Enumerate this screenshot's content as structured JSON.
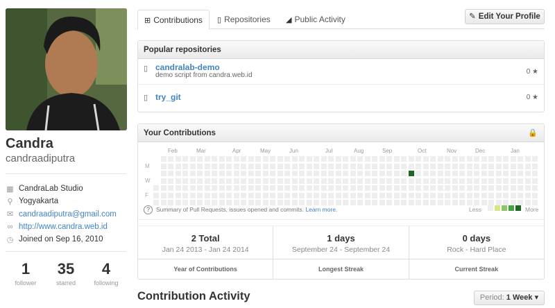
{
  "profile": {
    "fullname": "Candra",
    "username": "candraadiputra",
    "details": [
      {
        "icon": "building-icon",
        "glyph": "▦",
        "text": "CandraLab Studio",
        "link": false
      },
      {
        "icon": "location-icon",
        "glyph": "♥",
        "text": "Yogyakarta",
        "link": false
      },
      {
        "icon": "mail-icon",
        "glyph": "✉",
        "text": "candraadiputra@gmail.com",
        "link": true
      },
      {
        "icon": "link-icon",
        "glyph": "∞",
        "text": "http://www.candra.web.id",
        "link": true
      },
      {
        "icon": "clock-icon",
        "glyph": "◷",
        "text": "Joined on Sep 16, 2010",
        "link": false
      }
    ],
    "stats": [
      {
        "value": "1",
        "label": "follower"
      },
      {
        "value": "35",
        "label": "starred"
      },
      {
        "value": "4",
        "label": "following"
      }
    ]
  },
  "tabs": [
    {
      "label": "Contributions",
      "icon": "plus-box-icon",
      "glyph": "⊞",
      "selected": true
    },
    {
      "label": "Repositories",
      "icon": "repo-icon",
      "glyph": "▯",
      "selected": false
    },
    {
      "label": "Public Activity",
      "icon": "rss-icon",
      "glyph": "◢",
      "selected": false
    }
  ],
  "edit_profile_label": "Edit Your Profile",
  "popular": {
    "title": "Popular repositories",
    "repos": [
      {
        "name": "candralab-demo",
        "description": "demo script from candra.web.id",
        "stars": "0"
      },
      {
        "name": "try_git",
        "description": "",
        "stars": "0"
      }
    ]
  },
  "contributions": {
    "title": "Your Contributions",
    "months": [
      "Feb",
      "Mar",
      "Apr",
      "May",
      "Jun",
      "Jul",
      "Aug",
      "Sep",
      "Oct",
      "Nov",
      "Dec",
      "Jan"
    ],
    "days": [
      "M",
      "W",
      "F"
    ],
    "summary_text": "Summary of Pull Requests, issues opened and commits.",
    "learn_more": "Learn more.",
    "legend_less": "Less",
    "legend_more": "More",
    "legend_colors": [
      "#eeeeee",
      "#d6e685",
      "#8cc665",
      "#44a340",
      "#1e6823"
    ],
    "empty_color": "#eeeeee",
    "active_cell": {
      "week": 35,
      "day": 2,
      "color": "#1e6823"
    }
  },
  "stats": [
    {
      "big": "2 Total",
      "range": "Jan 24 2013 - Jan 24 2014",
      "label": "Year of Contributions"
    },
    {
      "big": "1 days",
      "range": "September 24 - September 24",
      "label": "Longest Streak"
    },
    {
      "big": "0 days",
      "range": "Rock - Hard Place",
      "label": "Current Streak"
    }
  ],
  "activity": {
    "title": "Contribution Activity",
    "period_label": "Period:",
    "period_value": "1 Week"
  }
}
